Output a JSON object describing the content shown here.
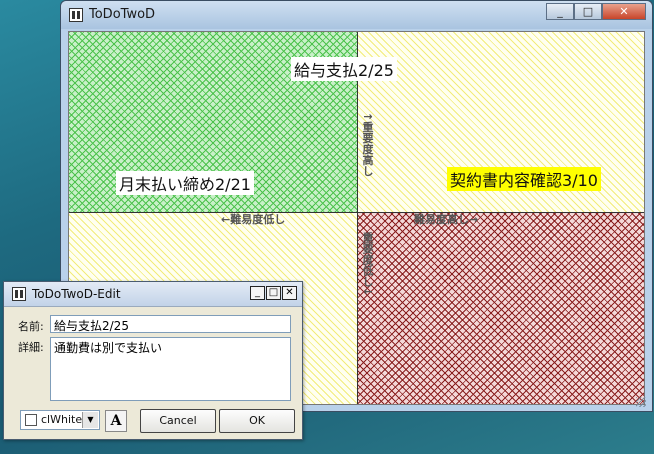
{
  "main_window": {
    "title": "ToDoTwoD",
    "buttons": {
      "minimize": "_",
      "maximize": "□",
      "close": "✕"
    },
    "axis": {
      "importance_high": "↑重要度高し",
      "importance_low": "重要度低し↓",
      "difficulty_low": "←難易度低し",
      "difficulty_high": "難易度高し→"
    },
    "tasks": [
      {
        "label": "給与支払2/25",
        "color": "#ffffff"
      },
      {
        "label": "月末払い締め2/21",
        "color": "#ffffff"
      },
      {
        "label": "契約書内容確認3/10",
        "color": "#ffff00"
      }
    ]
  },
  "edit_window": {
    "title": "ToDoTwoD-Edit",
    "buttons": {
      "minimize": "_",
      "maximize": "□",
      "close": "✕"
    },
    "name_label": "名前:",
    "name_value": "給与支払2/25",
    "detail_label": "詳細:",
    "detail_value": "通勤費は別で支払い",
    "color_value": "clWhite",
    "font_button": "A",
    "cancel_label": "Cancel",
    "ok_label": "OK"
  }
}
